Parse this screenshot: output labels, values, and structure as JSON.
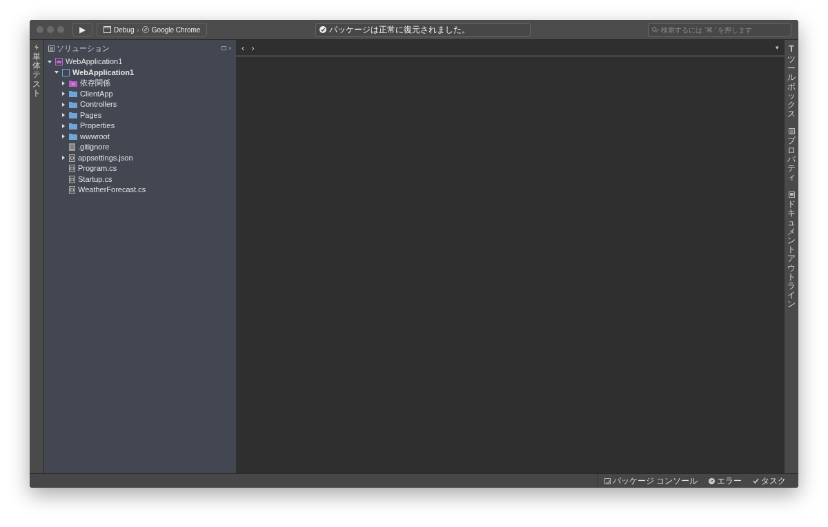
{
  "toolbar": {
    "run_symbol": "▶",
    "configuration": "Debug",
    "separator": "›",
    "target": "Google Chrome",
    "status": "パッケージは正常に復元されました。",
    "search": {
      "placeholder": "検索するには '⌘.' を押します"
    }
  },
  "left_strip": {
    "label": "単体テスト"
  },
  "solution_panel": {
    "title": "ソリューション",
    "close": "×",
    "tree": [
      {
        "label": "WebApplication1",
        "kind": "solution",
        "expanded": true,
        "children": [
          {
            "label": "WebApplication1",
            "kind": "project",
            "bold": true,
            "expanded": true,
            "children": [
              {
                "label": "依存関係",
                "kind": "dependencies",
                "expanded": false
              },
              {
                "label": "ClientApp",
                "kind": "folder",
                "expanded": false
              },
              {
                "label": "Controllers",
                "kind": "folder",
                "expanded": false
              },
              {
                "label": "Pages",
                "kind": "folder",
                "expanded": false
              },
              {
                "label": "Properties",
                "kind": "folder",
                "expanded": false
              },
              {
                "label": "wwwroot",
                "kind": "folder",
                "expanded": false
              },
              {
                "label": ".gitignore",
                "kind": "text"
              },
              {
                "label": "appsettings.json",
                "kind": "code",
                "expanded": false
              },
              {
                "label": "Program.cs",
                "kind": "code"
              },
              {
                "label": "Startup.cs",
                "kind": "code"
              },
              {
                "label": "WeatherForecast.cs",
                "kind": "code"
              }
            ]
          }
        ]
      }
    ]
  },
  "editor": {
    "back": "‹",
    "forward": "›",
    "menu": "▾"
  },
  "right_strip": [
    {
      "label": "ツールボックス",
      "kind": "toolbox",
      "glyph": "T"
    },
    {
      "label": "プロパティ",
      "kind": "properties"
    },
    {
      "label": "ドキュメントアウトライン",
      "kind": "outline"
    }
  ],
  "status_bar": [
    {
      "label": "パッケージ コンソール",
      "kind": "console"
    },
    {
      "label": "エラー",
      "kind": "error"
    },
    {
      "label": "タスク",
      "kind": "tasks"
    }
  ]
}
